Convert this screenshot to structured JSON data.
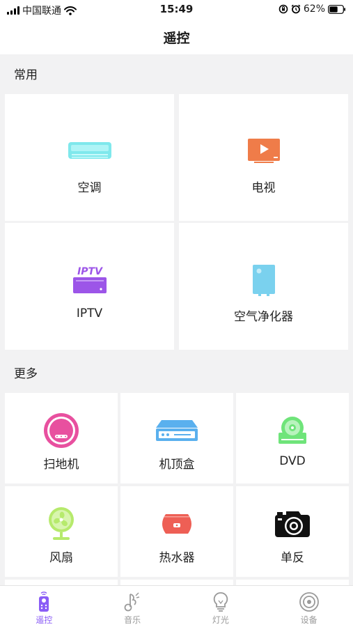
{
  "status_bar": {
    "carrier": "中国联通",
    "time": "15:49",
    "battery": "62%",
    "battery_level": 0.62
  },
  "header": {
    "title": "遥控"
  },
  "sections": {
    "common": {
      "title": "常用",
      "items": [
        {
          "label": "空调",
          "icon": "air-conditioner-icon",
          "color": "#7fe8ec"
        },
        {
          "label": "电视",
          "icon": "tv-icon",
          "color": "#ef7c49"
        },
        {
          "label": "IPTV",
          "icon": "iptv-box-icon",
          "color": "#9c55e8"
        },
        {
          "label": "空气净化器",
          "icon": "air-purifier-icon",
          "color": "#7ad1ee"
        }
      ]
    },
    "more": {
      "title": "更多",
      "items": [
        {
          "label": "扫地机",
          "icon": "robot-vacuum-icon",
          "color": "#e8509f"
        },
        {
          "label": "机顶盒",
          "icon": "set-top-box-icon",
          "color": "#5ab0ee"
        },
        {
          "label": "DVD",
          "icon": "dvd-player-icon",
          "color": "#6fe47a"
        },
        {
          "label": "风扇",
          "icon": "fan-icon",
          "color": "#b6ea6c"
        },
        {
          "label": "热水器",
          "icon": "water-heater-icon",
          "color": "#ee5f55"
        },
        {
          "label": "单反",
          "icon": "camera-icon",
          "color": "#111111"
        }
      ]
    }
  },
  "iptv_icon_text": "IPTV",
  "tab_bar": {
    "items": [
      {
        "label": "遥控",
        "icon": "remote-control-icon",
        "active": true
      },
      {
        "label": "音乐",
        "icon": "music-note-icon",
        "active": false
      },
      {
        "label": "灯光",
        "icon": "light-bulb-icon",
        "active": false
      },
      {
        "label": "设备",
        "icon": "device-icon",
        "active": false
      }
    ],
    "active_color": "#8a5cf6",
    "inactive_color": "#9a9a9a"
  }
}
